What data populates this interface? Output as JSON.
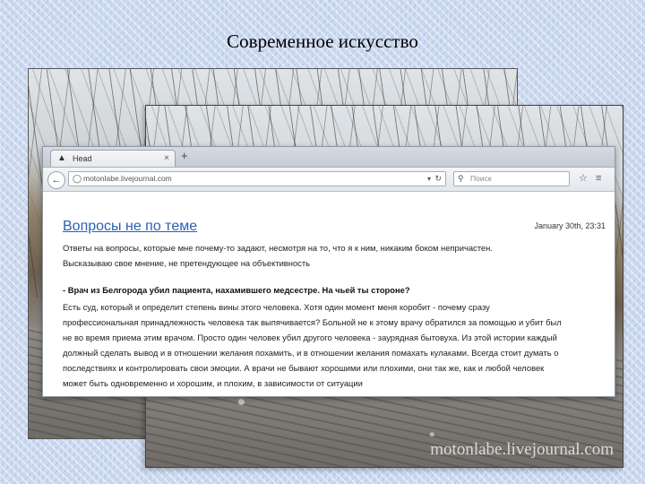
{
  "slide": {
    "title": "Современное искусство"
  },
  "photo": {
    "watermark": "motonlabe.livejournal.com"
  },
  "browser": {
    "tab_title": "Head",
    "tab_close": "×",
    "new_tab": "+",
    "url": "motonlabe.livejournal.com",
    "search_placeholder": "Поиск"
  },
  "post": {
    "title": "Вопросы не по теме",
    "date": "January 30th, 23:31",
    "intro_lines": [
      "Ответы на вопросы, которые мне почему-то задают, несмотря на то, что я к ним, никаким боком непричастен.",
      "Высказываю свое мнение, не претендующее на объективность"
    ],
    "question": "- Врач из Белгорода убил пациента, нахамившего медсестре. На чьей ты стороне?",
    "answer_lines": [
      "Есть суд, который и определит степень вины этого человека. Хотя один момент меня коробит - почему сразу",
      "профессиональная принадлежность человека так выпячивается? Больной не к этому врачу обратился за помощью и убит был",
      "не во время приема этим врачом. Просто один человек убил другого человека - заурядная бытовуха. Из этой истории каждый",
      "должный сделать вывод и в отношении желания похамить, и в отношении желания помахать кулаками. Всегда стоит думать о",
      "последствиях и контролировать свои эмоции. А врачи не бывают хорошими или плохими, они так же, как и любой человек",
      "может быть одновременно и хорошим, и плохим, в зависимости от ситуации"
    ]
  }
}
